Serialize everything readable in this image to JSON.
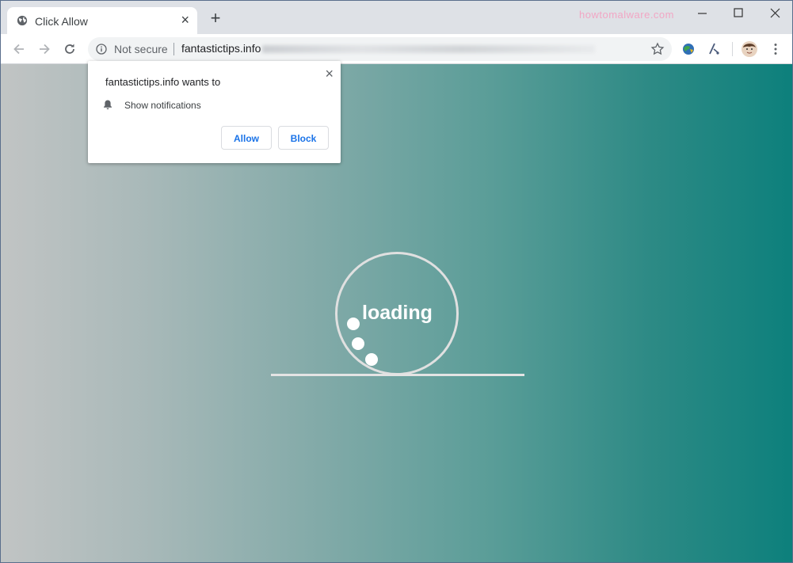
{
  "tab": {
    "title": "Click Allow",
    "close": "×"
  },
  "new_tab": "+",
  "watermark": "howtomalware.com",
  "address_bar": {
    "security_label": "Not secure",
    "url": "fantastictips.info"
  },
  "permission_popup": {
    "title": "fantastictips.info wants to",
    "permission": "Show notifications",
    "allow_label": "Allow",
    "block_label": "Block",
    "close": "×"
  },
  "loader": {
    "text": "loading"
  },
  "icons": [
    "globe-icon",
    "close-icon",
    "plus-icon",
    "minimize-icon",
    "maximize-icon",
    "back-icon",
    "forward-icon",
    "reload-icon",
    "info-icon",
    "star-icon",
    "extension-icon",
    "profile-avatar",
    "menu-icon",
    "bell-icon"
  ],
  "colors": {
    "accent": "#1a73e8",
    "page_gradient_start": "#c1c4c4",
    "page_gradient_end": "#0d807c"
  }
}
